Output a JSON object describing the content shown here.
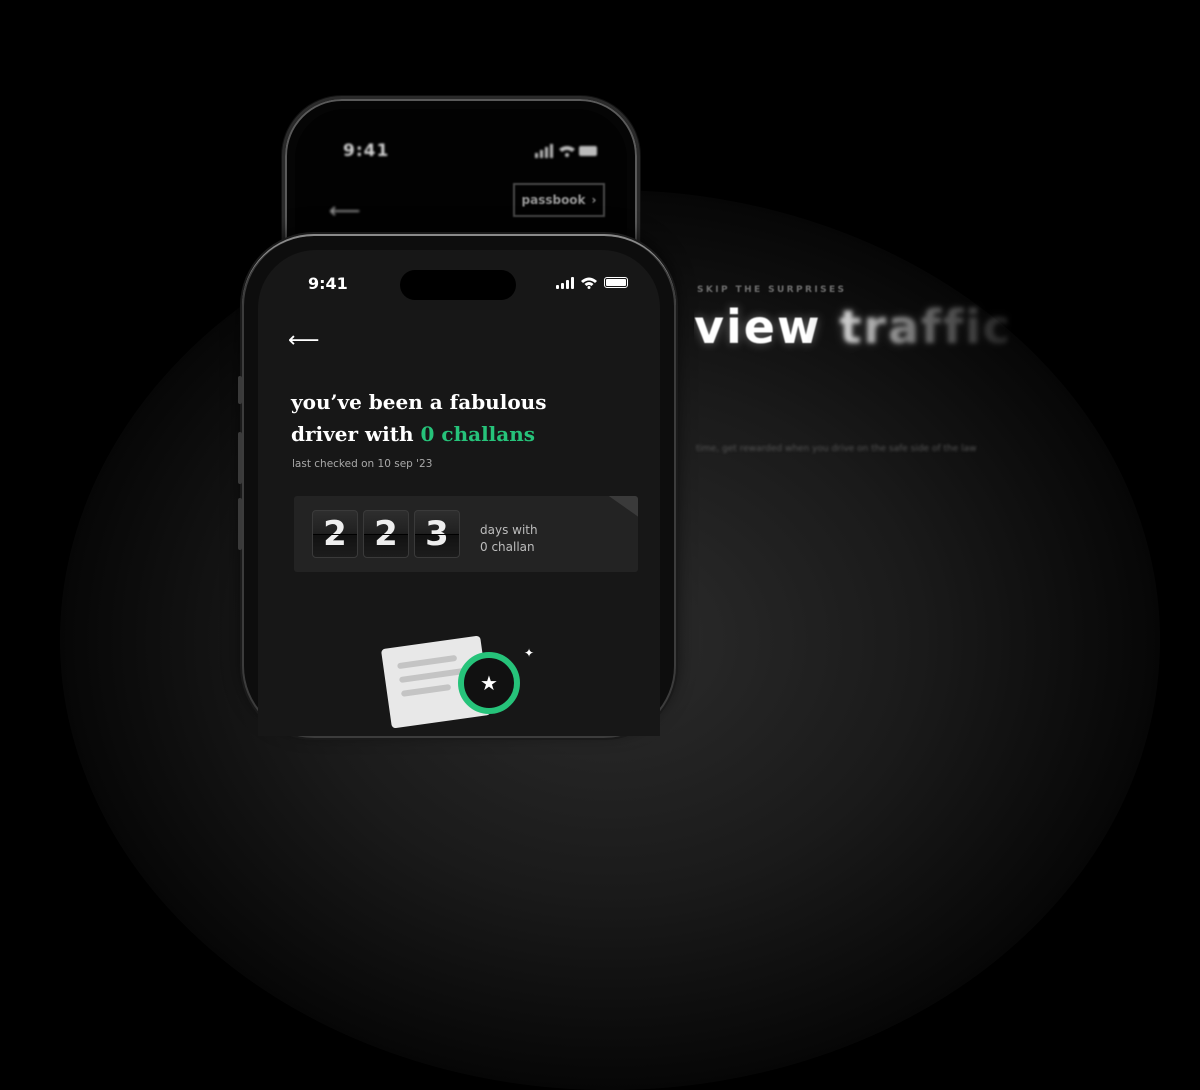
{
  "back_phone": {
    "time": "9:41",
    "passbook_label": "passbook",
    "passbook_chevron": "›"
  },
  "front_phone": {
    "time": "9:41",
    "back_arrow": "⟵",
    "headline_line1": "you’ve been a fabulous",
    "headline_line2_prefix": "driver with ",
    "headline_highlight": "0 challans",
    "last_checked": "last checked on 10 sep '23",
    "counter_digits": [
      "2",
      "2",
      "3"
    ],
    "counter_label_line1": "days with",
    "counter_label_line2": "0 challan",
    "badge_icon": "★",
    "sparkle": "✦"
  },
  "hero": {
    "kicker": "SKIP THE SURPRISES",
    "title_sharp": "view",
    "title_soft": "traffic",
    "subline": "time, get rewarded when you drive on the safe side of the law"
  },
  "colors": {
    "accent_green": "#26c37a",
    "background": "#000000"
  },
  "icons": [
    "back-arrow-icon",
    "signal-icon",
    "wifi-icon",
    "battery-icon",
    "chevron-right-icon",
    "star-badge-icon",
    "sparkle-icon",
    "document-icon"
  ]
}
